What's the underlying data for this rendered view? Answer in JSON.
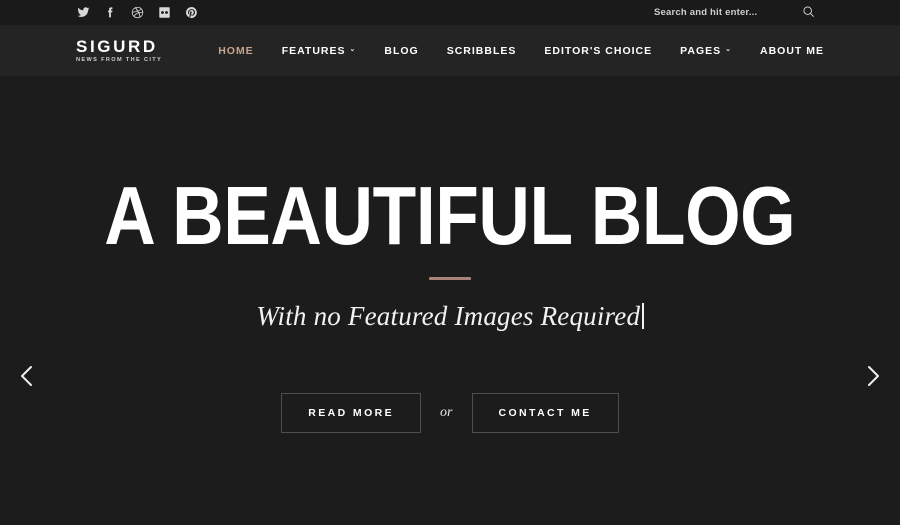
{
  "topbar": {
    "social": [
      {
        "name": "twitter-icon",
        "label": "Twitter"
      },
      {
        "name": "facebook-icon",
        "label": "Facebook"
      },
      {
        "name": "dribbble-icon",
        "label": "Dribbble"
      },
      {
        "name": "flickr-icon",
        "label": "Flickr"
      },
      {
        "name": "pinterest-icon",
        "label": "Pinterest"
      }
    ],
    "search": {
      "placeholder": "Search and hit enter...",
      "value": "",
      "icon": "search-icon"
    }
  },
  "header": {
    "brand": {
      "name": "SIGURD",
      "tagline": "NEWS FROM THE CITY"
    },
    "accent_color": "#c3a68f",
    "nav": [
      {
        "label": "HOME",
        "active": true,
        "has_dropdown": false
      },
      {
        "label": "FEATURES",
        "active": false,
        "has_dropdown": true
      },
      {
        "label": "BLOG",
        "active": false,
        "has_dropdown": false
      },
      {
        "label": "SCRIBBLES",
        "active": false,
        "has_dropdown": false
      },
      {
        "label": "EDITOR'S CHOICE",
        "active": false,
        "has_dropdown": false
      },
      {
        "label": "PAGES",
        "active": false,
        "has_dropdown": true
      },
      {
        "label": "ABOUT ME",
        "active": false,
        "has_dropdown": false
      }
    ],
    "dropdown_caret": "⌄"
  },
  "hero": {
    "title": "A BEAUTIFUL BLOG",
    "divider_color": "#a98476",
    "subtitle": "With no Featured Images Required",
    "primary_button": "READ MORE",
    "separator": "or",
    "secondary_button": "CONTACT ME",
    "prev_arrow": "prev-slide-icon",
    "next_arrow": "next-slide-icon",
    "background_color": "#1c1c1c"
  }
}
